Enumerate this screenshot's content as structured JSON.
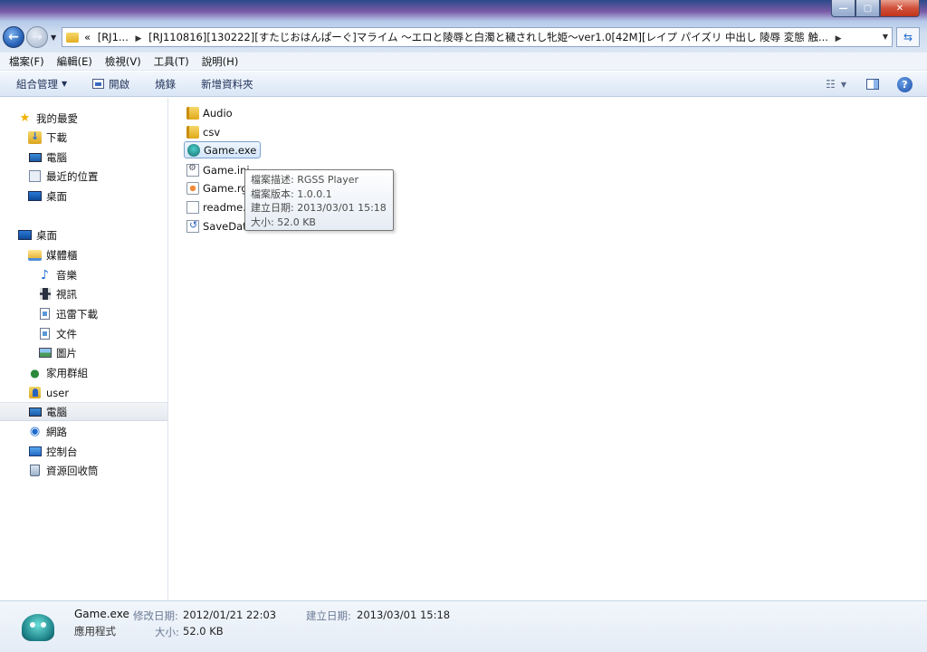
{
  "address": {
    "overflow": "«",
    "segments": [
      "[RJ1...",
      "[RJ110816][130222][すたじおはんぱーぐ]マライム ～エロと陵辱と白濁と穢されし牝姫～ver1.0[42M][レイプ パイズリ 中出し 陵辱 変態 触..."
    ]
  },
  "menu": [
    "檔案(F)",
    "編輯(E)",
    "檢視(V)",
    "工具(T)",
    "說明(H)"
  ],
  "commands": {
    "organize": "組合管理",
    "open": "開啟",
    "burn": "燒錄",
    "new_folder": "新增資料夾"
  },
  "nav": {
    "favorites": "我的最愛",
    "downloads": "下載",
    "computer_fav": "電腦",
    "recent": "最近的位置",
    "desktop_fav": "桌面",
    "desktop": "桌面",
    "libraries": "媒體櫃",
    "music": "音樂",
    "videos": "視訊",
    "thunder": "迅雷下載",
    "documents": "文件",
    "pictures": "圖片",
    "homegroup": "家用群組",
    "user": "user",
    "computer": "電腦",
    "network": "網路",
    "control_panel": "控制台",
    "recycle_bin": "資源回收筒"
  },
  "files": [
    {
      "name": "Audio",
      "icon": "folder-icon"
    },
    {
      "name": "csv",
      "icon": "folder-icon"
    },
    {
      "name": "Game.exe",
      "icon": "game-exe-icon"
    },
    {
      "name": "Game.ini",
      "icon": "settings-file-icon"
    },
    {
      "name": "Game.rg",
      "icon": "rgss-archive-icon"
    },
    {
      "name": "readme.",
      "icon": "text-file-icon"
    },
    {
      "name": "SaveDat",
      "icon": "save-file-icon"
    }
  ],
  "tooltip": {
    "description": "檔案描述: RGSS Player",
    "version": "檔案版本: 1.0.0.1",
    "created": "建立日期: 2013/03/01 15:18",
    "size": "大小: 52.0 KB"
  },
  "details": {
    "name": "Game.exe",
    "type": "應用程式",
    "modified_label": "修改日期:",
    "modified": "2012/01/21 22:03",
    "created_label": "建立日期:",
    "created": "2013/03/01 15:18",
    "size_label": "大小:",
    "size": "52.0 KB"
  },
  "colors": {
    "selection": "#d4e6fb",
    "selection_border": "#7da2ce",
    "label_gray": "#6a7a94"
  }
}
